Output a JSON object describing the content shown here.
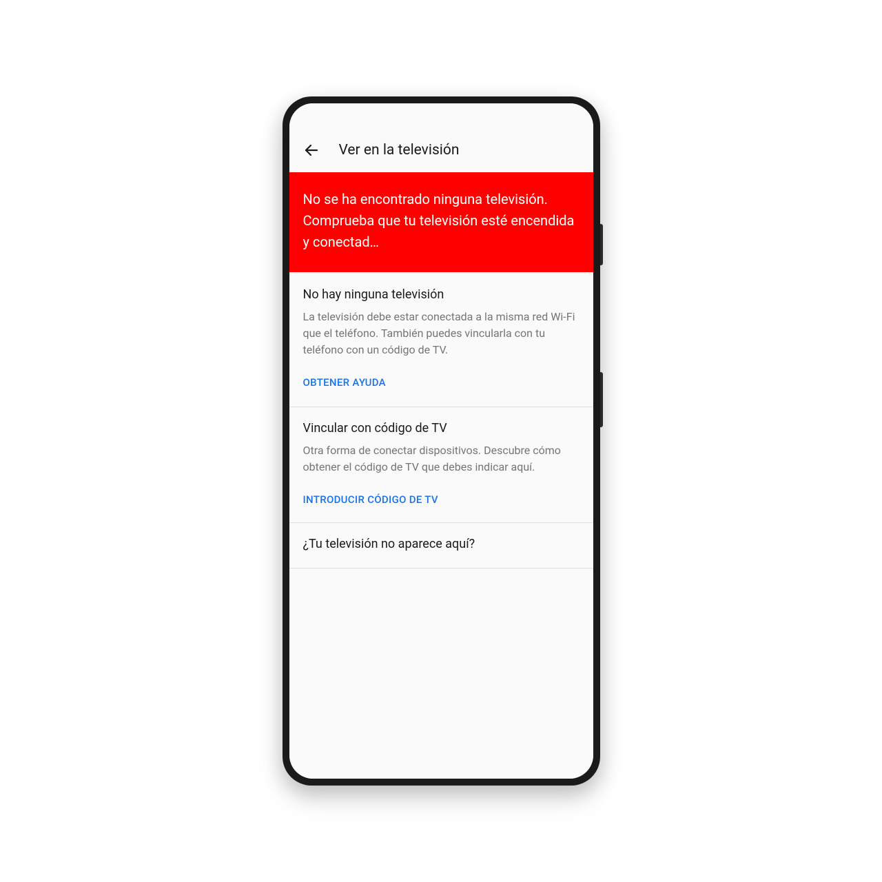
{
  "header": {
    "title": "Ver en la televisión"
  },
  "alert": {
    "message": "No se ha encontrado ninguna televisión. Comprueba que tu televisión esté encendida y conectad…"
  },
  "sections": {
    "no_tv": {
      "title": "No hay ninguna televisión",
      "body": "La televisión debe estar conectada a la misma red Wi-Fi que el teléfono. También puedes vincularla con tu teléfono con un código de TV.",
      "action": "OBTENER AYUDA"
    },
    "link_code": {
      "title": "Vincular con código de TV",
      "body": "Otra forma de conectar dispositivos. Descubre cómo obtener el código de TV que debes indicar aquí.",
      "action": "INTRODUCIR CÓDIGO DE TV"
    },
    "not_showing": {
      "title": "¿Tu televisión no aparece aquí?"
    }
  },
  "colors": {
    "alert_bg": "#ff0000",
    "link": "#1a73e8",
    "text_secondary": "#757575"
  }
}
